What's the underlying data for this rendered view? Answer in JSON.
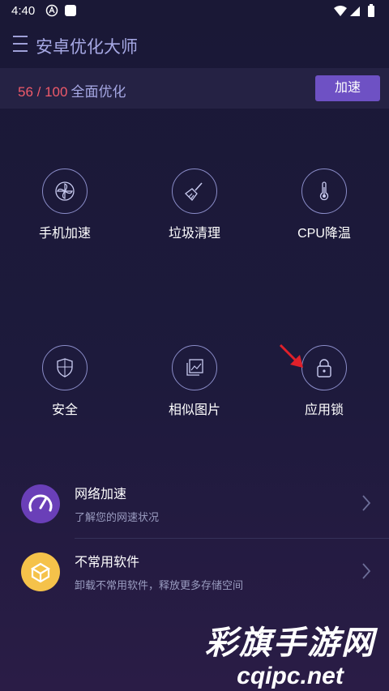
{
  "status_bar": {
    "time": "4:40"
  },
  "app_bar": {
    "title": "安卓优化大师"
  },
  "score": {
    "value": "56 / 100",
    "label": "全面优化",
    "button_label": "加速"
  },
  "tools": [
    {
      "label": "手机加速",
      "icon": "fan-icon"
    },
    {
      "label": "垃圾清理",
      "icon": "broom-icon"
    },
    {
      "label": "CPU降温",
      "icon": "thermometer-icon"
    },
    {
      "label": "安全",
      "icon": "shield-icon"
    },
    {
      "label": "相似图片",
      "icon": "photos-icon"
    },
    {
      "label": "应用锁",
      "icon": "lock-icon"
    }
  ],
  "list": [
    {
      "title": "网络加速",
      "subtitle": "了解您的网速状况",
      "icon": "speedometer-icon",
      "color": "#6a3fb8"
    },
    {
      "title": "不常用软件",
      "subtitle": "卸载不常用软件，释放更多存储空间",
      "icon": "box-icon",
      "color": "#f5c24a"
    }
  ],
  "watermark": {
    "line1": "彩旗手游网",
    "line2": "cqipc.net"
  },
  "colors": {
    "accent": "#6e51c4",
    "score_number": "#ef5a6a",
    "title": "#a6a8e4"
  }
}
